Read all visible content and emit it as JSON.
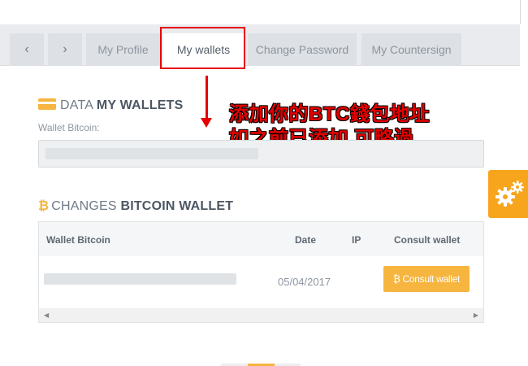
{
  "tabs": {
    "prev_glyph": "‹",
    "next_glyph": "›",
    "items": [
      {
        "label": "My Profile"
      },
      {
        "label": "My wallets"
      },
      {
        "label": "Change Password"
      },
      {
        "label": "My Countersign"
      }
    ]
  },
  "annotation": {
    "line1": "添加你的BTC錢包地址",
    "line2": "如之前已添加 可略過",
    "color": "#e60000"
  },
  "wallets_section": {
    "title_prefix": "DATA",
    "title_bold": "MY WALLETS",
    "field_label": "Wallet Bitcoin:",
    "icon": "credit-card-icon"
  },
  "changes_section": {
    "icon_glyph": "₿",
    "title_prefix": "CHANGES",
    "title_bold": "BITCOIN WALLET"
  },
  "table": {
    "headers": [
      "Wallet Bitcoin",
      "Date",
      "IP",
      "Consult wallet"
    ],
    "rows": [
      {
        "date": "05/04/2017",
        "action": "₿ Consult wallet"
      }
    ],
    "scroll_left": "◀",
    "scroll_right": "▶"
  },
  "colors": {
    "accent": "#f5b53f",
    "gear_widget": "#f7a51c",
    "tab_bar": "#e9ebee"
  }
}
